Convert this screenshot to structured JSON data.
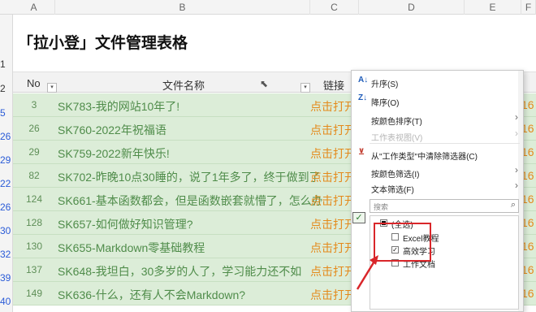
{
  "columns": [
    "A",
    "B",
    "C",
    "D",
    "E",
    "F"
  ],
  "row_numbers": {
    "title_row": "1",
    "header_row": "2",
    "data_rows": [
      "5",
      "26",
      "29",
      "22",
      "26",
      "30",
      "32",
      "39",
      "40"
    ]
  },
  "title": "「拉小登」文件管理表格",
  "headers": {
    "no": "No",
    "name": "文件名称",
    "link": "链接"
  },
  "rows": [
    {
      "no": "3",
      "name": "SK783-我的网站10年了!",
      "link": "点击打开",
      "last": "16"
    },
    {
      "no": "26",
      "name": "SK760-2022年祝福语",
      "link": "点击打开",
      "last": "16"
    },
    {
      "no": "29",
      "name": "SK759-2022新年快乐!",
      "link": "点击打开",
      "last": "16"
    },
    {
      "no": "82",
      "name": "SK702-昨晚10点30睡的，说了1年多了，终于做到了",
      "link": "点击打开",
      "last": "16"
    },
    {
      "no": "124",
      "name": "SK661-基本函数都会，但是函数嵌套就懵了，怎么办",
      "link": "点击打开",
      "last": "16"
    },
    {
      "no": "128",
      "name": "SK657-如何做好知识管理?",
      "link": "点击打开",
      "last": "16"
    },
    {
      "no": "130",
      "name": "SK655-Markdown零基础教程",
      "link": "点击打开",
      "last": "16"
    },
    {
      "no": "137",
      "name": "SK648-我坦白，30多岁的人了，学习能力还不如",
      "link": "点击打开",
      "last": "16"
    },
    {
      "no": "149",
      "name": "SK636-什么，还有人不会Markdown?",
      "link": "点击打开",
      "last": "16"
    }
  ],
  "filter_menu": {
    "sort_asc": "升序(S)",
    "sort_desc": "降序(O)",
    "sort_by_color": "按颜色排序(T)",
    "sheet_view": "工作表视图(V)",
    "clear_filter": "从\"工作类型\"中清除筛选器(C)",
    "filter_by_color": "按颜色筛选(I)",
    "text_filter": "文本筛选(F)",
    "search_placeholder": "搜索",
    "select_all": "(全选)",
    "options": [
      {
        "label": "Excel教程",
        "checked": false
      },
      {
        "label": "高效学习",
        "checked": true
      },
      {
        "label": "工作文档",
        "checked": false
      }
    ]
  },
  "colors": {
    "row_fill": "#dcedd8",
    "name_text": "#4f8c4a",
    "link_text": "#e48a1c",
    "annotation": "#d9262a"
  },
  "icons": [
    "sort-ascending-icon",
    "sort-descending-icon",
    "clear-filter-icon",
    "search-icon",
    "chevron-right-icon",
    "filter-dropdown-icon",
    "checkmark-icon",
    "red-arrow-icon"
  ]
}
